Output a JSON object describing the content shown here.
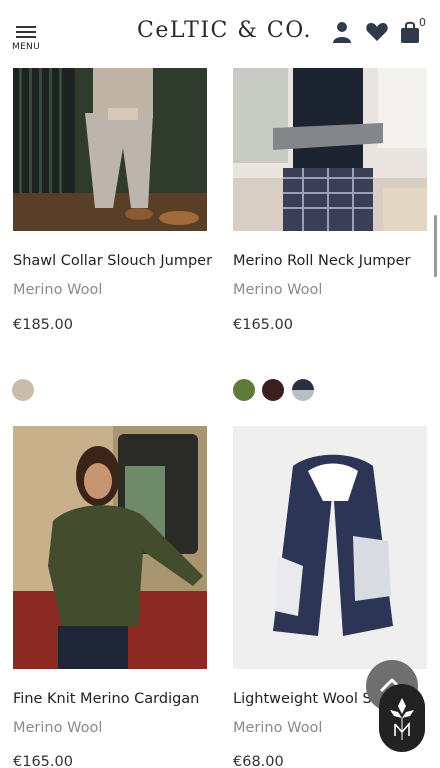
{
  "header": {
    "menu_label": "MENU",
    "logo_text": "CeLTIC & CO.",
    "bag_count": "0"
  },
  "products": [
    {
      "name": "Shawl Collar Slouch Jumper",
      "material": "Merino Wool",
      "price": "€185.00",
      "swatches": [
        "#cbbba9"
      ]
    },
    {
      "name": "Merino Roll Neck Jumper",
      "material": "Merino Wool",
      "price": "€165.00",
      "swatches": [
        "#5f7a3a",
        "#3a1f1c",
        "#2a3143/#b9bdc4"
      ]
    },
    {
      "name": "Fine Knit Merino Cardigan",
      "material": "Merino Wool",
      "price": "€165.00"
    },
    {
      "name": "Lightweight Wool Scarf",
      "material": "Merino Wool",
      "price": "€68.00"
    }
  ],
  "colors": {
    "accent_dark": "#222222",
    "back_to_top": "#6f6f6f"
  }
}
